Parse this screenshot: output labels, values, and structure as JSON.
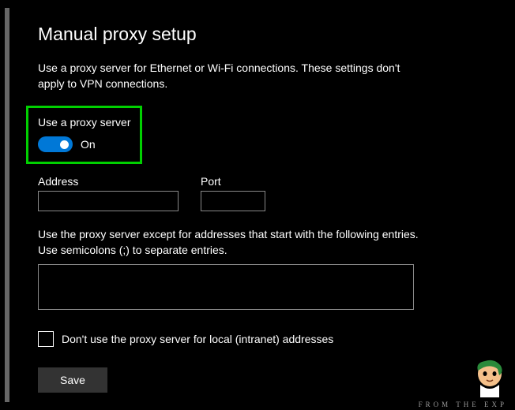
{
  "page": {
    "title": "Manual proxy setup",
    "description": "Use a proxy server for Ethernet or Wi-Fi connections. These settings don't apply to VPN connections."
  },
  "proxy": {
    "toggle_label": "Use a proxy server",
    "toggle_state": "On",
    "address_label": "Address",
    "address_value": "",
    "port_label": "Port",
    "port_value": "",
    "exceptions_description": "Use the proxy server except for addresses that start with the following entries. Use semicolons (;) to separate entries.",
    "exceptions_value": "",
    "local_checkbox_label": "Don't use the proxy server for local (intranet) addresses",
    "local_checked": false,
    "save_label": "Save"
  },
  "watermark": "FROM THE EXP",
  "colors": {
    "accent": "#0078d7",
    "highlight": "#00d000"
  }
}
